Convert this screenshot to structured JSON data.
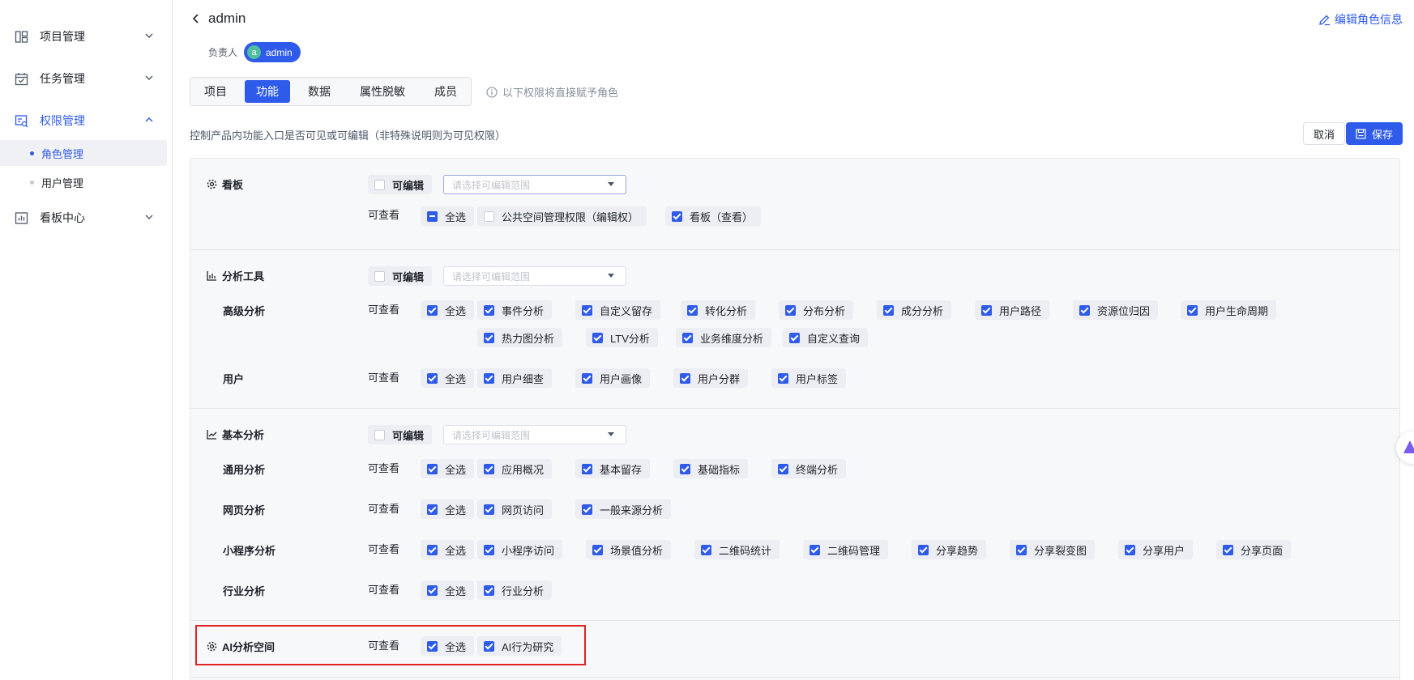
{
  "sidebar": {
    "groups": [
      {
        "label": "项目管理",
        "icon": "layout-icon"
      },
      {
        "label": "任务管理",
        "icon": "calendar-check-icon"
      },
      {
        "label": "权限管理",
        "icon": "permission-icon"
      },
      {
        "label": "看板中心",
        "icon": "chart-board-icon"
      }
    ],
    "sub_items": [
      "角色管理",
      "用户管理"
    ]
  },
  "header": {
    "title": "admin",
    "edit_link": "编辑角色信息",
    "owner_label": "负责人",
    "owner_avatar": "a",
    "owner_name": "admin"
  },
  "tabs": [
    "项目",
    "功能",
    "数据",
    "属性脱敏",
    "成员"
  ],
  "tab_hint": "以下权限将直接赋予角色",
  "description": "控制产品内功能入口是否可见或可编辑（非特殊说明则为可见权限）",
  "buttons": {
    "cancel": "取消",
    "save": "保存"
  },
  "labels": {
    "editable": "可编辑",
    "viewable": "可查看",
    "range_placeholder": "请选择可编辑范围",
    "select_all": "全选"
  },
  "sections": {
    "dashboard": {
      "title": "看板",
      "options": [
        "公共空间管理权限（编辑权）",
        "看板（查看）"
      ]
    },
    "analysis_tools": {
      "title": "分析工具",
      "advanced": {
        "title": "高级分析",
        "options": [
          "事件分析",
          "自定义留存",
          "转化分析",
          "分布分析",
          "成分分析",
          "用户路径",
          "资源位归因",
          "用户生命周期",
          "热力图分析",
          "LTV分析",
          "业务维度分析",
          "自定义查询"
        ]
      },
      "user": {
        "title": "用户",
        "options": [
          "用户细查",
          "用户画像",
          "用户分群",
          "用户标签"
        ]
      }
    },
    "basic_analysis": {
      "title": "基本分析",
      "general": {
        "title": "通用分析",
        "options": [
          "应用概况",
          "基本留存",
          "基础指标",
          "终端分析"
        ]
      },
      "web": {
        "title": "网页分析",
        "options": [
          "网页访问",
          "一般来源分析"
        ]
      },
      "miniprogram": {
        "title": "小程序分析",
        "options": [
          "小程序访问",
          "场景值分析",
          "二维码统计",
          "二维码管理",
          "分享趋势",
          "分享裂变图",
          "分享用户",
          "分享页面"
        ]
      },
      "industry": {
        "title": "行业分析",
        "options": [
          "行业分析"
        ]
      }
    },
    "ai_space": {
      "title": "AI分析空间",
      "options": [
        "AI行为研究"
      ]
    }
  },
  "colors": {
    "accent": "#2f5bea",
    "highlight": "#e02424",
    "panel_bg": "#f7f8fa"
  }
}
